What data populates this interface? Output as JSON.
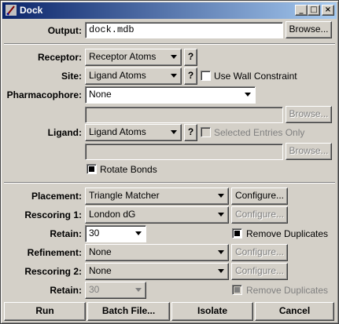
{
  "window": {
    "title": "Dock"
  },
  "titlebar_buttons": {
    "minimize": "_",
    "maximize": "□",
    "close": "×"
  },
  "output": {
    "label": "Output:",
    "value": "dock.mdb",
    "browse": "Browse..."
  },
  "receptor": {
    "label": "Receptor:",
    "value": "Receptor Atoms",
    "help": "?"
  },
  "site": {
    "label": "Site:",
    "value": "Ligand Atoms",
    "help": "?",
    "wall_label": "Use Wall Constraint",
    "wall_checked": false
  },
  "pharmacophore": {
    "label": "Pharmacophore:",
    "value": "None",
    "browse": "Browse..."
  },
  "ligand": {
    "label": "Ligand:",
    "value": "Ligand Atoms",
    "help": "?",
    "selected_only_label": "Selected Entries Only",
    "browse": "Browse..."
  },
  "rotate_bonds": {
    "label": "Rotate Bonds",
    "checked": true
  },
  "placement": {
    "label": "Placement:",
    "value": "Triangle Matcher",
    "configure": "Configure..."
  },
  "rescoring1": {
    "label": "Rescoring 1:",
    "value": "London dG",
    "configure": "Configure..."
  },
  "retain1": {
    "label": "Retain:",
    "value": "30",
    "remove_dup_label": "Remove Duplicates",
    "remove_dup_checked": true
  },
  "refinement": {
    "label": "Refinement:",
    "value": "None",
    "configure": "Configure..."
  },
  "rescoring2": {
    "label": "Rescoring 2:",
    "value": "None",
    "configure": "Configure..."
  },
  "retain2": {
    "label": "Retain:",
    "value": "30",
    "remove_dup_label": "Remove Duplicates",
    "remove_dup_checked": true
  },
  "actions": {
    "run": "Run",
    "batch": "Batch File...",
    "isolate": "Isolate",
    "cancel": "Cancel"
  }
}
